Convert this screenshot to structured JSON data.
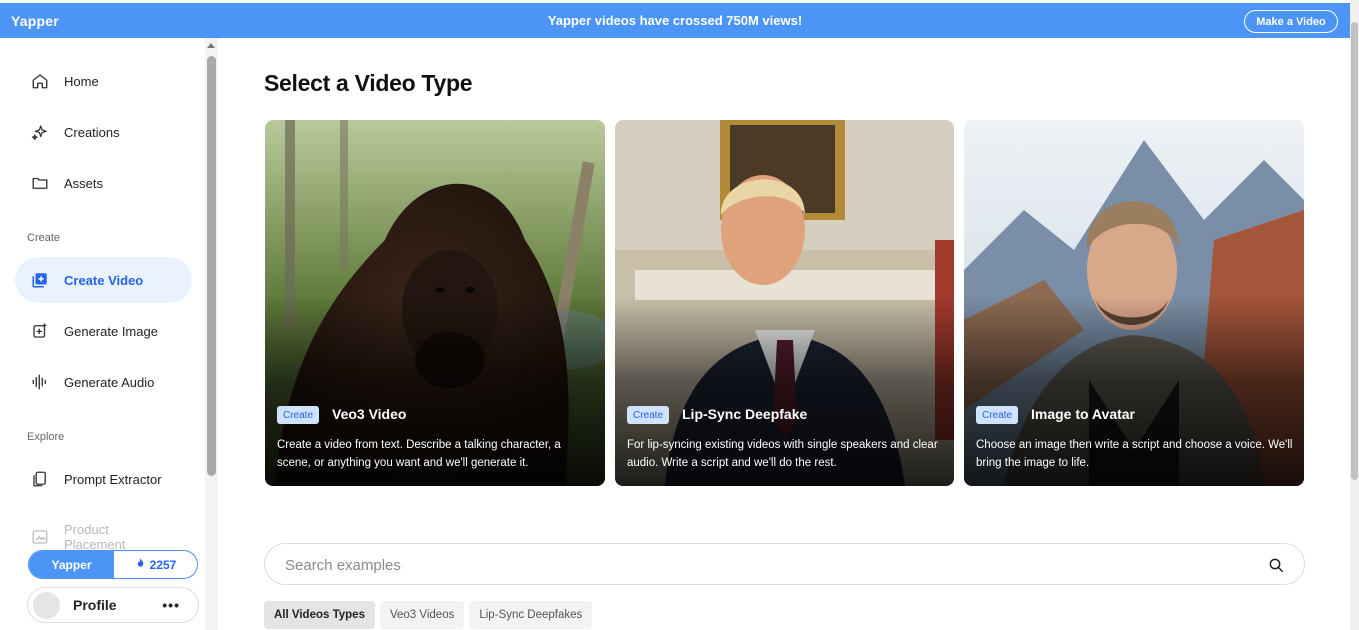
{
  "banner": {
    "logo": "Yapper",
    "announcement": "Yapper videos have crossed 750M views!",
    "cta": "Make a Video"
  },
  "sidebar": {
    "items": [
      {
        "label": "Home",
        "icon": "home-icon"
      },
      {
        "label": "Creations",
        "icon": "sparkle-icon"
      },
      {
        "label": "Assets",
        "icon": "folder-icon"
      }
    ],
    "create_label": "Create",
    "create_items": [
      {
        "label": "Create Video",
        "icon": "plus-square-icon",
        "active": true
      },
      {
        "label": "Generate Image",
        "icon": "image-plus-icon"
      },
      {
        "label": "Generate Audio",
        "icon": "waveform-icon"
      }
    ],
    "explore_label": "Explore",
    "explore_items": [
      {
        "label": "Prompt Extractor",
        "icon": "copy-icon"
      },
      {
        "label": "Product Placement",
        "icon": "image-icon",
        "dimmed": true
      }
    ],
    "credits": {
      "brand": "Yapper",
      "count": "2257",
      "icon": "flame-icon"
    },
    "profile": {
      "name": "Profile",
      "more": "•••"
    }
  },
  "main": {
    "title": "Select a Video Type",
    "cards": [
      {
        "tag": "Create",
        "title": "Veo3 Video",
        "description": "Create a video from text. Describe a talking character, a scene, or anything you want and we'll generate it."
      },
      {
        "tag": "Create",
        "title": "Lip-Sync Deepfake",
        "description": "For lip-syncing existing videos with single speakers and clear audio. Write a script and we'll do the rest."
      },
      {
        "tag": "Create",
        "title": "Image to Avatar",
        "description": "Choose an image then write a script and choose a voice. We'll bring the image to life."
      }
    ],
    "search": {
      "placeholder": "Search examples",
      "value": ""
    },
    "filters": [
      {
        "label": "All Videos Types",
        "active": true
      },
      {
        "label": "Veo3 Videos"
      },
      {
        "label": "Lip-Sync Deepfakes"
      }
    ]
  },
  "colors": {
    "accent": "#4c95f7",
    "active_text": "#2563eb",
    "active_bg": "#eaf2fd"
  }
}
